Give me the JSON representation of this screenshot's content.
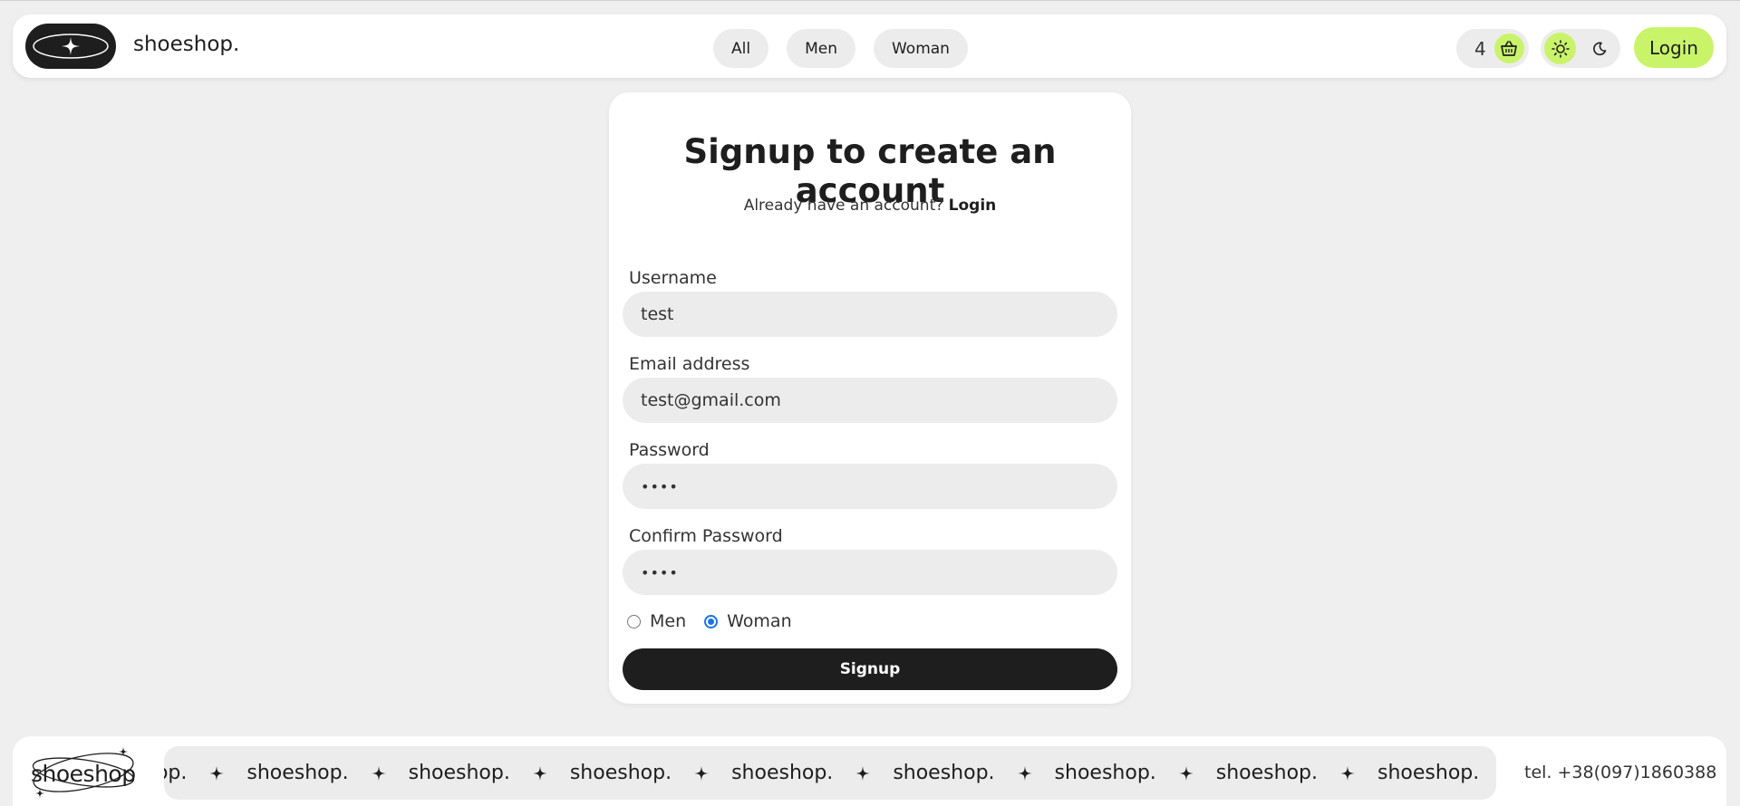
{
  "header": {
    "brand": "shoeshop.",
    "logo_icon": "sparkle-icon",
    "nav": [
      {
        "label": "All"
      },
      {
        "label": "Men"
      },
      {
        "label": "Woman"
      }
    ],
    "cart_count": "4",
    "cart_icon": "basket-icon",
    "theme_icons": [
      "sun-icon",
      "moon-icon"
    ],
    "login_label": "Login",
    "accent_color": "#c9f46a"
  },
  "signup": {
    "title": "Signup to create an account",
    "subtitle": "Already have an account?",
    "subtitle_link": "Login",
    "fields": [
      {
        "label": "Username",
        "value": "test"
      },
      {
        "label": "Email address",
        "value": "test@gmail.com"
      },
      {
        "label": "Password",
        "value": "••••"
      },
      {
        "label": "Confirm Password",
        "value": "••••"
      }
    ],
    "gender_options": [
      {
        "label": "Men",
        "checked": false
      },
      {
        "label": "Woman",
        "checked": true
      }
    ],
    "submit_label": "Signup"
  },
  "footer": {
    "logo_text": "shoeshop",
    "marquee_first": "hop.",
    "marquee_word": "shoeshop.",
    "phone": "tel. +38(097)1860388"
  }
}
